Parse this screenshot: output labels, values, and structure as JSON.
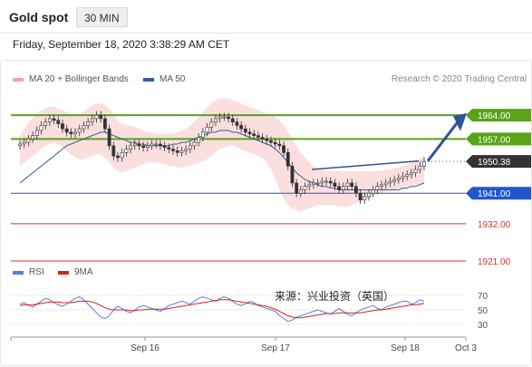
{
  "header": {
    "title": "Gold spot",
    "timeframe": "30 MIN"
  },
  "date_line": "Friday, September 18, 2020 3:38:29 AM CET",
  "legend": {
    "bollinger": "MA 20 + Bollinger Bands",
    "ma50": "MA 50",
    "credit": "Research © 2020 Trading Central",
    "rsi": "RSI",
    "rsi_ma": "9MA"
  },
  "watermark": "来源：兴业投资（英国）",
  "colors": {
    "green": "#5aa218",
    "blue": "#2255cc",
    "red": "#d83030",
    "dark": "#333333",
    "bb": "#f8c4c4",
    "ma50": "#3a5a9c",
    "rsi": "#5b7fd6",
    "rsi_ma": "#d62020",
    "arrow": "#2f5597"
  },
  "chart_data": {
    "type": "candlestick",
    "price_axis": {
      "range": [
        1921,
        1971
      ]
    },
    "x_ticks": [
      "Sep 16",
      "Sep 17",
      "Sep 18",
      "Oct 3"
    ],
    "levels": [
      {
        "label": "1964.00",
        "value": 1964.0,
        "style": "green"
      },
      {
        "label": "1957.00",
        "value": 1957.0,
        "style": "green"
      },
      {
        "label": "1950.38",
        "value": 1950.38,
        "style": "dark"
      },
      {
        "label": "1941.00",
        "value": 1941.0,
        "style": "blue"
      },
      {
        "label": "1932.00",
        "value": 1932.0,
        "style": "red"
      },
      {
        "label": "1921.00",
        "value": 1921.0,
        "style": "red"
      }
    ],
    "close": [
      1955.5,
      1956,
      1957,
      1958,
      1959.5,
      1961,
      1962,
      1963,
      1962.5,
      1961.5,
      1960,
      1959,
      1958.5,
      1959,
      1960,
      1961,
      1962,
      1963,
      1964,
      1963,
      1960,
      1955,
      1952,
      1951.5,
      1953,
      1954,
      1955,
      1955.5,
      1955,
      1954.5,
      1955,
      1955.5,
      1955.5,
      1955,
      1954.5,
      1954,
      1953.5,
      1953,
      1953.5,
      1954,
      1955,
      1956,
      1957.5,
      1959,
      1960.5,
      1962,
      1963,
      1963.5,
      1963.5,
      1963,
      1962,
      1961,
      1960,
      1959,
      1958.5,
      1958,
      1957.5,
      1957,
      1956.5,
      1956,
      1955.5,
      1955,
      1953,
      1949,
      1944,
      1941,
      1942,
      1943,
      1943.5,
      1944,
      1944,
      1944.5,
      1944.5,
      1944,
      1943,
      1942,
      1943,
      1944,
      1943,
      1941,
      1939,
      1940,
      1941,
      1942,
      1943,
      1943.5,
      1944,
      1944.5,
      1945,
      1945.5,
      1946,
      1946.5,
      1947,
      1948,
      1949,
      1950.38
    ],
    "ma50": [
      1944,
      1945,
      1946,
      1947,
      1948,
      1949,
      1950,
      1951,
      1952,
      1953,
      1954,
      1955,
      1955.5,
      1956,
      1956.5,
      1957,
      1957.5,
      1958,
      1958.5,
      1959,
      1959,
      1958.5,
      1958,
      1957.5,
      1957,
      1956.5,
      1956,
      1956,
      1955.5,
      1955.5,
      1955,
      1955,
      1955,
      1955,
      1955,
      1955,
      1955.5,
      1955.5,
      1956,
      1956,
      1956.5,
      1957,
      1957.5,
      1958,
      1958.5,
      1959,
      1959,
      1959.5,
      1959.5,
      1959.5,
      1959,
      1959,
      1958.5,
      1958,
      1957.5,
      1957,
      1956.5,
      1956,
      1955.5,
      1955,
      1954,
      1953,
      1951.5,
      1950,
      1948.5,
      1947,
      1946,
      1945,
      1944.5,
      1944,
      1943.5,
      1943,
      1943,
      1942.5,
      1942.5,
      1942,
      1942,
      1942,
      1942,
      1942,
      1942,
      1942,
      1942,
      1942,
      1942,
      1942,
      1942,
      1942,
      1942,
      1942,
      1942.5,
      1942.5,
      1943,
      1943,
      1943.5,
      1944
    ],
    "bb_upper": [
      1958,
      1960,
      1962,
      1963,
      1964.5,
      1965.5,
      1966,
      1966.5,
      1966.5,
      1966,
      1965.5,
      1965,
      1964,
      1964,
      1964.5,
      1965,
      1966,
      1967,
      1967.5,
      1967.5,
      1967,
      1966,
      1964,
      1962.5,
      1961.5,
      1961,
      1961,
      1960.5,
      1960,
      1959.5,
      1959,
      1959,
      1958.5,
      1958.5,
      1958.5,
      1958.5,
      1958.5,
      1959,
      1959.5,
      1960,
      1961,
      1962,
      1963.5,
      1965,
      1966.5,
      1967.5,
      1968.5,
      1969,
      1969,
      1969,
      1968.5,
      1968,
      1967.5,
      1967,
      1966.5,
      1966,
      1965.5,
      1965,
      1964.5,
      1964,
      1963.5,
      1962.5,
      1961,
      1959,
      1957,
      1955,
      1953,
      1951.5,
      1950,
      1949,
      1948.5,
      1948,
      1947.5,
      1947.5,
      1947.5,
      1947.5,
      1947.5,
      1947.5,
      1947.5,
      1947.5,
      1947.5,
      1947.5,
      1947.5,
      1947.5,
      1947.5,
      1947.5,
      1948,
      1948,
      1948.5,
      1948.5,
      1949,
      1949.5,
      1950,
      1950.5,
      1951,
      1952
    ],
    "bb_lower": [
      1949,
      1950,
      1951,
      1952,
      1953,
      1954,
      1955,
      1955.5,
      1956,
      1955.5,
      1954.5,
      1953.5,
      1952.5,
      1951.5,
      1951,
      1951,
      1951.5,
      1952,
      1952.5,
      1952.5,
      1951.5,
      1950,
      1948.5,
      1947.5,
      1947,
      1947.5,
      1948,
      1948.5,
      1949,
      1949.5,
      1950,
      1950,
      1950,
      1950,
      1949.5,
      1949,
      1949,
      1948.5,
      1948.5,
      1949,
      1949,
      1949.5,
      1950,
      1950.5,
      1951,
      1952,
      1953,
      1954,
      1954.5,
      1955,
      1955,
      1954.5,
      1954,
      1953.5,
      1953,
      1952.5,
      1952,
      1951.5,
      1950,
      1948,
      1945,
      1942,
      1939.5,
      1937.5,
      1936.5,
      1936,
      1935.5,
      1936,
      1936.5,
      1937,
      1937.5,
      1937.5,
      1937.5,
      1937.5,
      1937.5,
      1937,
      1937,
      1937,
      1937.5,
      1938,
      1938.5,
      1939,
      1939.5,
      1940,
      1940.5,
      1941,
      1941.5,
      1942,
      1942,
      1942.5,
      1942.5,
      1943,
      1943,
      1943.5,
      1943.5,
      1944
    ],
    "rsi": [
      58,
      60,
      56,
      54,
      58,
      62,
      66,
      64,
      60,
      57,
      55,
      58,
      62,
      66,
      68,
      64,
      58,
      52,
      46,
      40,
      38,
      42,
      50,
      55,
      52,
      48,
      46,
      50,
      54,
      56,
      54,
      52,
      50,
      48,
      52,
      56,
      58,
      60,
      62,
      60,
      58,
      62,
      66,
      68,
      66,
      64,
      62,
      66,
      68,
      66,
      62,
      58,
      56,
      58,
      62,
      60,
      56,
      54,
      52,
      50,
      48,
      42,
      38,
      34,
      36,
      40,
      42,
      44,
      46,
      48,
      50,
      48,
      46,
      44,
      48,
      52,
      48,
      44,
      42,
      46,
      50,
      52,
      54,
      56,
      52,
      50,
      54,
      56,
      58,
      60,
      62,
      62,
      58,
      60,
      64,
      62
    ],
    "rsi_ma": [
      56,
      57,
      57,
      57,
      58,
      59,
      60,
      61,
      61,
      61,
      60,
      60,
      60,
      61,
      62,
      62,
      62,
      61,
      59,
      56,
      53,
      51,
      50,
      50,
      50,
      50,
      49,
      49,
      50,
      50,
      51,
      51,
      51,
      51,
      51,
      52,
      53,
      54,
      55,
      56,
      57,
      58,
      59,
      60,
      61,
      62,
      63,
      64,
      64,
      64,
      63,
      62,
      61,
      60,
      59,
      58,
      57,
      56,
      55,
      53,
      51,
      48,
      45,
      42,
      40,
      39,
      39,
      40,
      41,
      42,
      43,
      44,
      45,
      45,
      45,
      46,
      46,
      46,
      46,
      46,
      46,
      47,
      48,
      49,
      50,
      50,
      51,
      52,
      53,
      54,
      55,
      56,
      57,
      57,
      58,
      59
    ],
    "rsi_axis": {
      "ticks": [
        70,
        50,
        30
      ]
    }
  }
}
